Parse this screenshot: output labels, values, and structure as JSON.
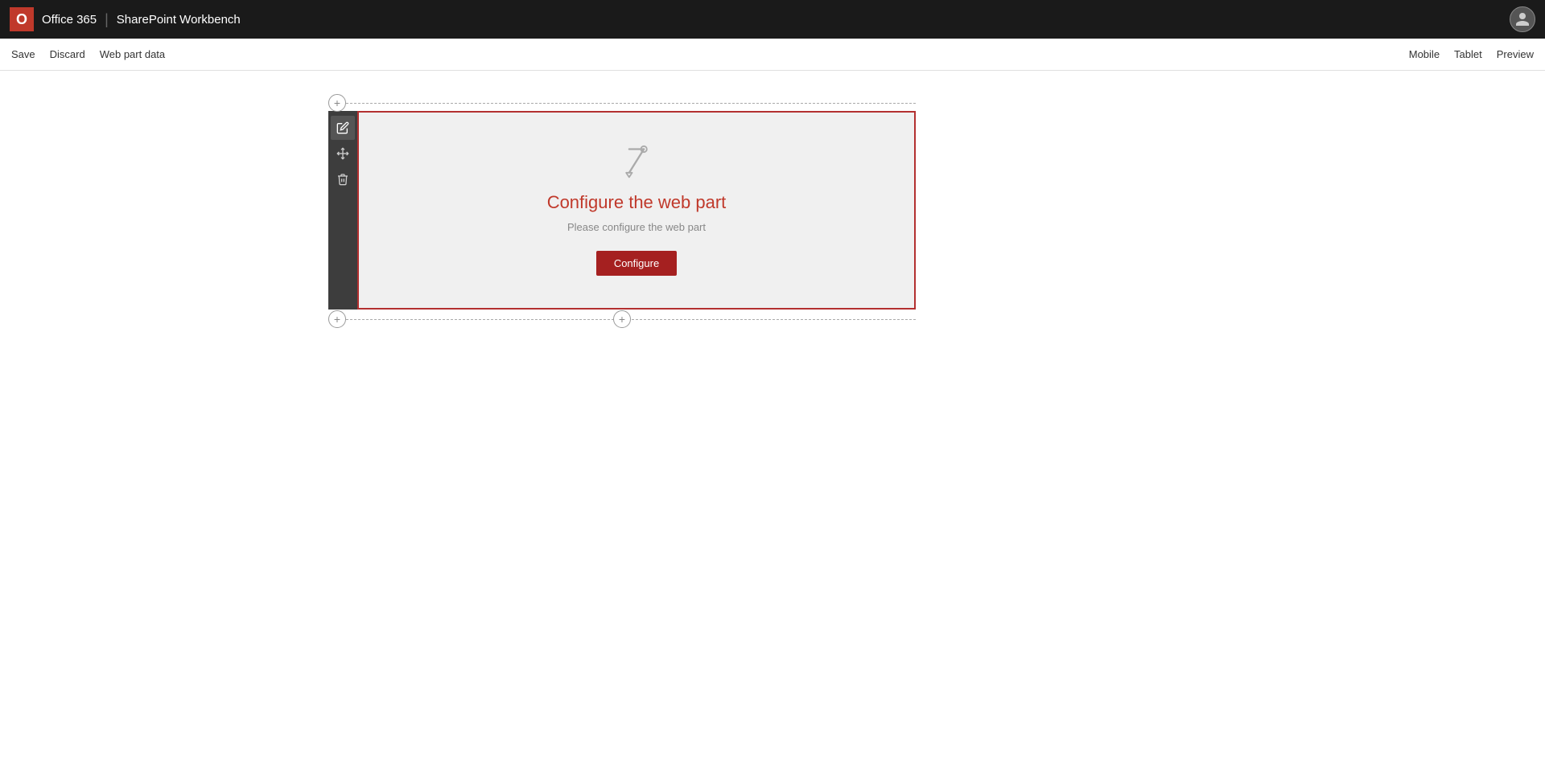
{
  "topbar": {
    "app_name": "Office 365",
    "divider": "|",
    "subtitle": "SharePoint Workbench"
  },
  "toolbar": {
    "save_label": "Save",
    "discard_label": "Discard",
    "web_part_data_label": "Web part data",
    "mobile_label": "Mobile",
    "tablet_label": "Tablet",
    "preview_label": "Preview"
  },
  "webpart": {
    "title_part1": "Configure ",
    "title_highlight": "the",
    "title_part2": " web part",
    "subtitle": "Please configure the web part",
    "configure_button": "Configure"
  },
  "icons": {
    "add": "+",
    "edit": "✏",
    "move": "✥",
    "delete": "🗑"
  }
}
